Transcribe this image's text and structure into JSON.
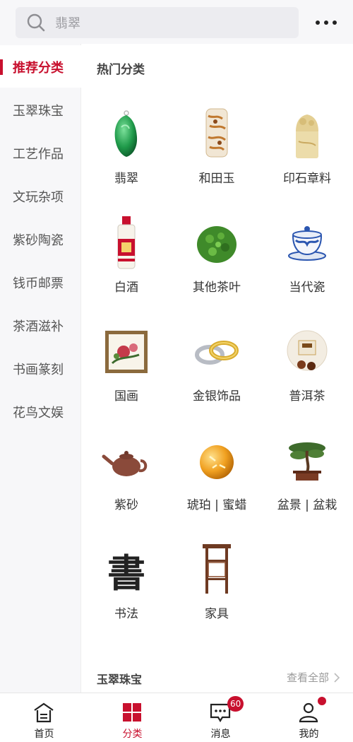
{
  "search": {
    "placeholder": "翡翠",
    "icon": "search-icon"
  },
  "more_icon": "more-icon",
  "colors": {
    "accent": "#c8102e",
    "sidebar_bg": "#f7f7f9"
  },
  "sidebar": {
    "items": [
      {
        "label": "推荐分类",
        "active": true
      },
      {
        "label": "玉翠珠宝"
      },
      {
        "label": "工艺作品"
      },
      {
        "label": "文玩杂项"
      },
      {
        "label": "紫砂陶瓷"
      },
      {
        "label": "钱币邮票"
      },
      {
        "label": "茶酒滋补"
      },
      {
        "label": "书画篆刻"
      },
      {
        "label": "花鸟文娱"
      }
    ]
  },
  "main": {
    "section_title": "热门分类",
    "categories": [
      {
        "label": "翡翠",
        "icon": "jade-pendant-icon"
      },
      {
        "label": "和田玉",
        "icon": "hetian-jade-icon"
      },
      {
        "label": "印石章料",
        "icon": "seal-stone-icon"
      },
      {
        "label": "白酒",
        "icon": "liquor-bottle-icon"
      },
      {
        "label": "其他茶叶",
        "icon": "tea-leaves-icon"
      },
      {
        "label": "当代瓷",
        "icon": "porcelain-cup-icon"
      },
      {
        "label": "国画",
        "icon": "painting-icon"
      },
      {
        "label": "金银饰品",
        "icon": "rings-icon"
      },
      {
        "label": "普洱茶",
        "icon": "puer-tea-icon"
      },
      {
        "label": "紫砂",
        "icon": "teapot-icon"
      },
      {
        "label": "琥珀 | 蜜蜡",
        "icon": "amber-icon"
      },
      {
        "label": "盆景 | 盆栽",
        "icon": "bonsai-icon"
      },
      {
        "label": "书法",
        "icon": "calligraphy-icon"
      },
      {
        "label": "家具",
        "icon": "furniture-icon"
      }
    ],
    "calligraphy_glyph": "書",
    "jade_section": {
      "title": "玉翠珠宝",
      "view_all": "查看全部"
    }
  },
  "tabbar": {
    "items": [
      {
        "label": "首页",
        "icon": "home-icon"
      },
      {
        "label": "分类",
        "icon": "category-icon",
        "active": true
      },
      {
        "label": "消息",
        "icon": "message-icon",
        "badge": "60"
      },
      {
        "label": "我的",
        "icon": "profile-icon",
        "dot": true
      }
    ]
  }
}
